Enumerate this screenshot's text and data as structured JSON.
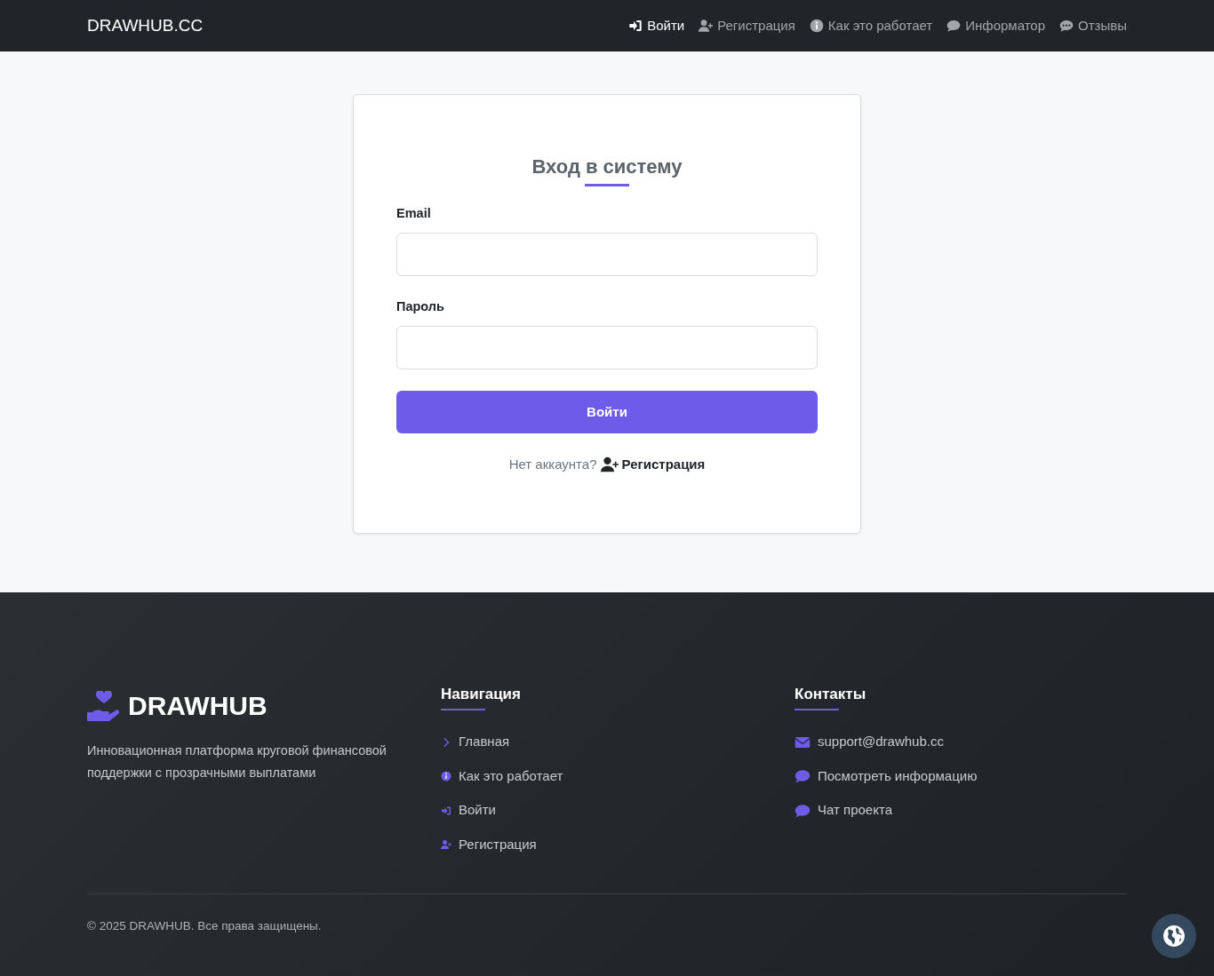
{
  "navbar": {
    "brand": "DRAWHUB.CC",
    "items": [
      {
        "label": "Войти",
        "kind": "login",
        "selected": true
      },
      {
        "label": "Регистрация",
        "kind": "signup",
        "selected": false
      },
      {
        "label": "Как это работает",
        "kind": "info",
        "selected": false
      },
      {
        "label": "Информатор",
        "kind": "chat",
        "selected": false
      },
      {
        "label": "Отзывы",
        "kind": "reviews",
        "selected": false
      }
    ]
  },
  "login_card": {
    "title": "Вход в систему",
    "fields": [
      {
        "label": "Email"
      },
      {
        "label": "Пароль"
      }
    ],
    "submit": "Войти",
    "signup_prompt": "Нет аккаунта?",
    "signup_link": "Регистрация"
  },
  "footer": {
    "brand": "DRAWHUB",
    "tagline": "Инновационная платформа круговой финансовой поддержки с прозрачными выплатами",
    "navigation": {
      "title": "Навигация",
      "links": [
        {
          "label": "Главная",
          "kind": "home"
        },
        {
          "label": "Как это работает",
          "kind": "info"
        },
        {
          "label": "Войти",
          "kind": "login"
        },
        {
          "label": "Регистрация",
          "kind": "signup"
        }
      ]
    },
    "contacts": {
      "title": "Контакты",
      "links": [
        {
          "label": "support@drawhub.cc",
          "kind": "email"
        },
        {
          "label": "Посмотреть информацию",
          "kind": "chat"
        },
        {
          "label": "Чат проекта",
          "kind": "chat"
        }
      ]
    },
    "copyright": "© 2025 DRAWHUB. Все права защищены."
  }
}
